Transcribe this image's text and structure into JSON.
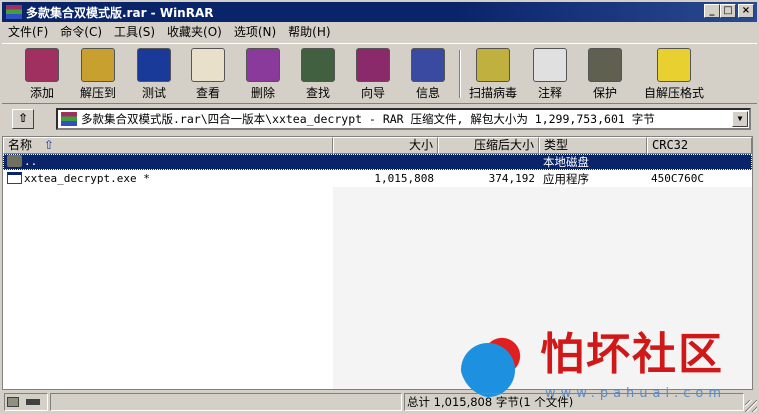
{
  "window": {
    "title": "多款集合双模式版.rar - WinRAR",
    "minimize": "_",
    "maximize": "□",
    "close": "×"
  },
  "menu": [
    "文件(F)",
    "命令(C)",
    "工具(S)",
    "收藏夹(O)",
    "选项(N)",
    "帮助(H)"
  ],
  "toolbar": [
    {
      "label": "添加",
      "icon": "add-icon",
      "color": "#a03060"
    },
    {
      "label": "解压到",
      "icon": "extract-icon",
      "color": "#c8a030"
    },
    {
      "label": "测试",
      "icon": "test-icon",
      "color": "#1a3a9a"
    },
    {
      "label": "查看",
      "icon": "view-icon",
      "color": "#e8e0c8"
    },
    {
      "label": "删除",
      "icon": "delete-icon",
      "color": "#8a3a9a"
    },
    {
      "label": "查找",
      "icon": "find-icon",
      "color": "#406040"
    },
    {
      "label": "向导",
      "icon": "wizard-icon",
      "color": "#8a2a6a"
    },
    {
      "label": "信息",
      "icon": "info-icon",
      "color": "#3a4aa0"
    },
    {
      "label": "扫描病毒",
      "icon": "virus-scan-icon",
      "color": "#c0b040"
    },
    {
      "label": "注释",
      "icon": "comment-icon",
      "color": "#e0e0e0"
    },
    {
      "label": "保护",
      "icon": "protect-icon",
      "color": "#606050"
    },
    {
      "label": "自解压格式",
      "icon": "sfx-icon",
      "color": "#e8d030"
    }
  ],
  "address": {
    "up": "⇧",
    "path": "多款集合双模式版.rar\\四合一版本\\xxtea_decrypt - RAR 压缩文件, 解包大小为 1,299,753,601 字节",
    "dropdown": "▼"
  },
  "columns": [
    "名称",
    "大小",
    "压缩后大小",
    "类型",
    "CRC32"
  ],
  "sort_arrow": "⇧",
  "rows": [
    {
      "name": "..",
      "size": "",
      "packed": "",
      "type": "本地磁盘",
      "crc": "",
      "selected": true,
      "icon": "folder-icon"
    },
    {
      "name": "xxtea_decrypt.exe *",
      "size": "1,015,808",
      "packed": "374,192",
      "type": "应用程序",
      "crc": "450C760C",
      "selected": false,
      "icon": "exe-icon"
    }
  ],
  "status": {
    "total": "总计 1,015,808 字节(1 个文件)"
  },
  "watermark": {
    "text": "怕坏社区",
    "url": "www.pahuai.com"
  }
}
